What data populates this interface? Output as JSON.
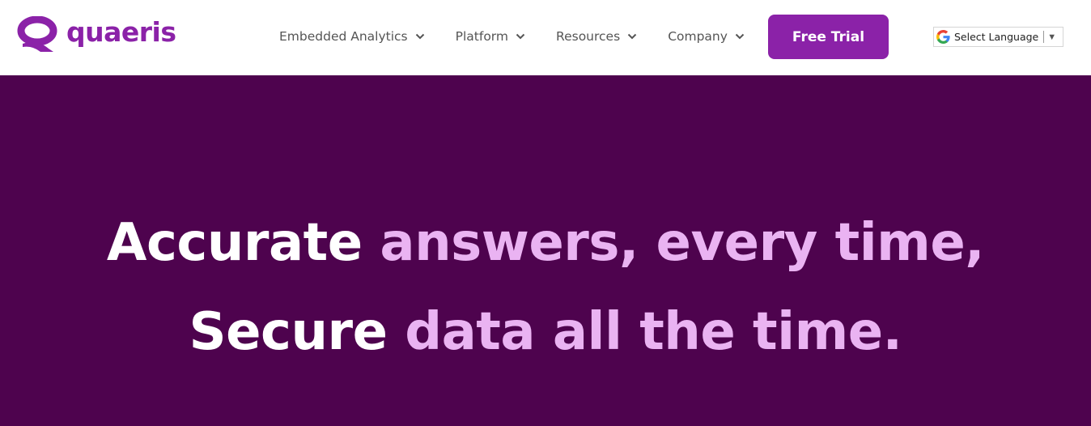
{
  "colors": {
    "brand_purple": "#8b22a8",
    "hero_background": "#4e034e",
    "hero_accent_text": "#eab3f2",
    "hero_white_text": "#ffffff",
    "nav_text": "#555555"
  },
  "header": {
    "logo": {
      "text": "quaeris",
      "icon": "quaeris-q-icon"
    },
    "nav": [
      {
        "label": "Embedded Analytics",
        "icon": "chevron-down-icon"
      },
      {
        "label": "Platform",
        "icon": "chevron-down-icon"
      },
      {
        "label": "Resources",
        "icon": "chevron-down-icon"
      },
      {
        "label": "Company",
        "icon": "chevron-down-icon"
      }
    ],
    "cta_label": "Free Trial",
    "translate": {
      "label": "Select Language",
      "arrow": "▼",
      "icon": "google-g-icon"
    }
  },
  "hero": {
    "line1": {
      "white": "Accurate",
      "accent": "answers, every time,"
    },
    "line2": {
      "white": "Secure",
      "accent": "data all the time."
    }
  }
}
